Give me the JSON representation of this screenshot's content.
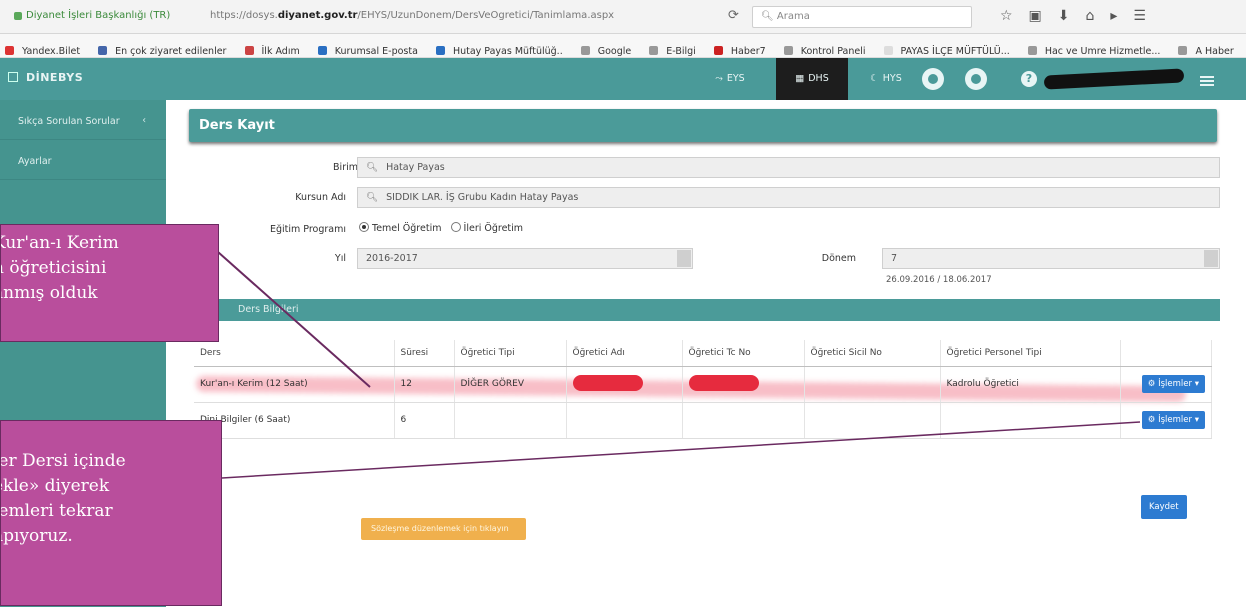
{
  "browser": {
    "site": "Diyanet İşleri Başkanlığı (TR)",
    "url_prefix": "https://dosys.",
    "url_host": "diyanet.gov.tr",
    "url_path": "/EHYS/UzunDonem/DersVeOgretici/Tanimlama.aspx",
    "search_placeholder": "Arama",
    "bookmarks": [
      "Yandex.Bilet",
      "En çok ziyaret edilenler",
      "İlk Adım",
      "Kurumsal E-posta",
      "Hutay Payas Müftülüğ..",
      "Google",
      "E-Bilgi",
      "Haber7",
      "Kontrol Paneli",
      "PAYAS İLÇE MÜFTÜLÜ...",
      "Hac ve Umre Hizmetle...",
      "A Haber"
    ]
  },
  "nav": {
    "brand": "DİNEBYS",
    "items": [
      "EYS",
      "DHS",
      "HYS"
    ]
  },
  "sidebar": {
    "items": [
      {
        "label": "Sıkça Sorulan Sorular",
        "chevron": "‹"
      },
      {
        "label": "Ayarlar"
      }
    ]
  },
  "form": {
    "title": "Ders Kayıt",
    "birim_label": "Birim",
    "birim_value": "Hatay Payas",
    "kurs_label": "Kursun Adı",
    "kurs_value": "SIDDIK LAR. İŞ Grubu Kadın Hatay Payas",
    "program_label": "Eğitim Programı",
    "program_options": [
      "Temel Öğretim",
      "İleri Öğretim"
    ],
    "yil_label": "Yıl",
    "yil_value": "2016-2017",
    "donem_label": "Dönem",
    "donem_value": "7",
    "donem_dates": "26.09.2016 / 18.06.2017",
    "section_title": "Ders Bilgileri"
  },
  "table": {
    "headers": [
      "Ders",
      "Süresi",
      "Öğretici Tipi",
      "Öğretici Adı",
      "Öğretici Tc No",
      "Öğretici Sicil No",
      "Öğretici Personel Tipi",
      ""
    ],
    "rows": [
      {
        "ders": "Kur'an-ı Kerim (12 Saat)",
        "sure": "12",
        "tip": "DİĞER GÖREV",
        "personel": "Kadrolu Öğretici",
        "button": "İşlemler"
      },
      {
        "ders": "Dini Bilgiler (6 Saat)",
        "sure": "6",
        "tip": "",
        "personel": "",
        "button": "İşlemler"
      }
    ]
  },
  "buttons": {
    "save": "Kaydet",
    "orange": "Sözleşme düzenlemek için tıklayın"
  },
  "notes": {
    "top": [
      "Kur'an-ı Kerim",
      "n öğreticisini",
      "anmış olduk"
    ],
    "bottom": [
      "ler Dersi içinde",
      "ekle» diyerek",
      "lemleri tekrar",
      "apıyoruz."
    ]
  },
  "colors": {
    "teal": "#4a9a99",
    "sidebar": "#45948f",
    "note": "#b94e9c",
    "primary_button": "#2d7bd1",
    "orange_button": "#f0b04d"
  }
}
